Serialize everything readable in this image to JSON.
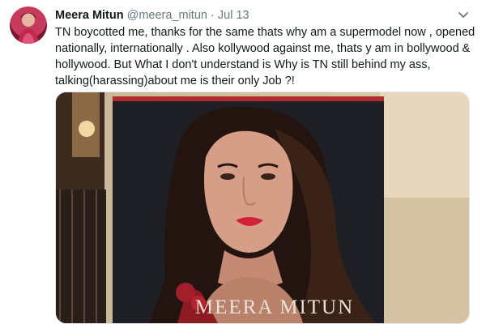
{
  "tweet": {
    "display_name": "Meera Mitun",
    "handle": "@meera_mitun",
    "separator": "·",
    "date": "Jul 13",
    "text": "TN boycotted me, thanks for the same thats why am a supermodel now , opened nationally, internationally . Also kollywood against me, thats y am in bollywood & hollywood. But What I don't understand is Why is TN still behind my ass, talking(harassing)about me is their only Job ?!",
    "image": {
      "poster_caption": "MEERA MITUN"
    }
  },
  "icons": {
    "avatar": "profile-avatar",
    "menu": "chevron-down-icon"
  },
  "colors": {
    "text": "#14171a",
    "secondary": "#657786",
    "border": "#e1e8ed"
  }
}
